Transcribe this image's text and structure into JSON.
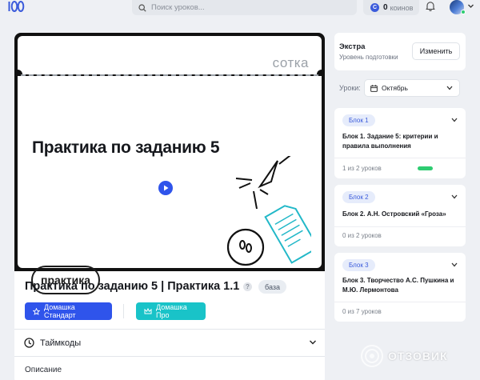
{
  "header": {
    "search_placeholder": "Поиск уроков...",
    "coins_count": "0",
    "coins_label": "коинов",
    "coin_glyph": "C"
  },
  "video": {
    "brand": "сотка",
    "slide_title": "Практика по заданию 5",
    "pill_text": "практика"
  },
  "lesson": {
    "title": "Практика по заданию 5 | Практика 1.1",
    "help": "?",
    "level_badge": "база",
    "buttons": {
      "standard": "Домашка Стандарт",
      "pro": "Домашка Про"
    },
    "timecodes_label": "Таймкоды",
    "description_label": "Описание"
  },
  "sidebar": {
    "extra": {
      "title": "Экстра",
      "subtitle": "Уровень подготовки",
      "change_label": "Изменить"
    },
    "lessons_label": "Уроки:",
    "month": "Октябрь",
    "blocks": [
      {
        "tag": "Блок 1",
        "title": "Блок 1. Задание 5: критерии и правила выполнения",
        "count": "1 из 2 уроков",
        "progress": 0.5
      },
      {
        "tag": "Блок 2",
        "title": "Блок 2. А.Н. Островский «Гроза»",
        "count": "0 из 2 уроков",
        "progress": 0
      },
      {
        "tag": "Блок 3",
        "title": "Блок 3. Творчество А.С. Пушкина и М.Ю. Лермонтова",
        "count": "0 из 7 уроков",
        "progress": 0
      }
    ]
  },
  "watermark": {
    "text": "ОТЗОВИК"
  },
  "colors": {
    "primary": "#2f54eb",
    "teal": "#19c3c8",
    "progress": "#2ecc71",
    "tag_bg": "#e6ecfb"
  }
}
